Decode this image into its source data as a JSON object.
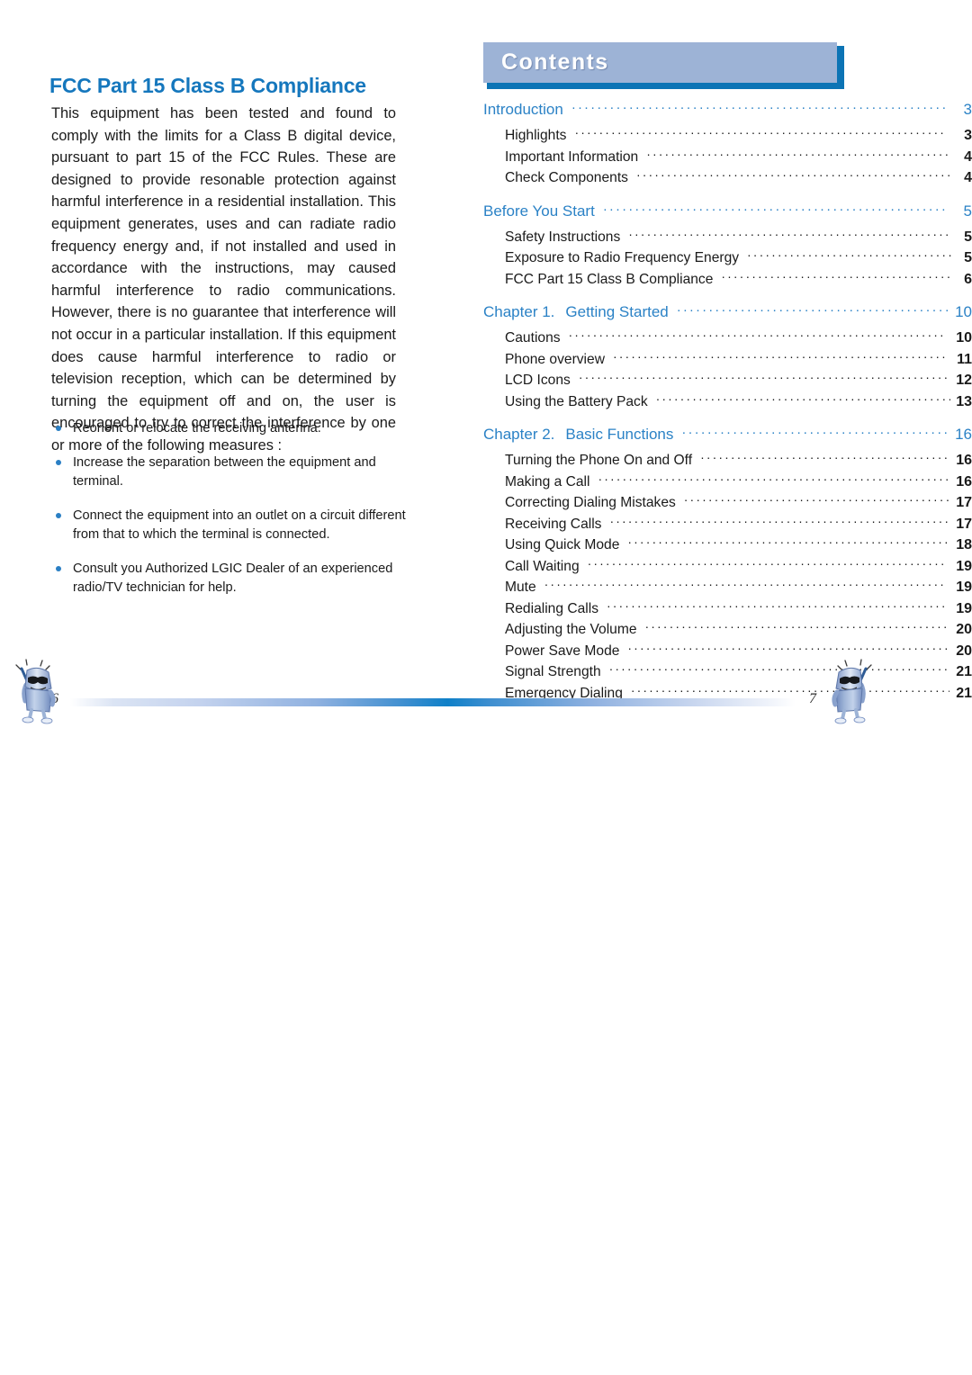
{
  "left_page": {
    "heading": "FCC Part 15 Class B Compliance",
    "body": "This equipment has been tested and found to comply with the limits for a Class B digital device, pursuant to part 15 of the FCC Rules. These are designed to provide resonable protection against harmful interference in a residential installation. This equipment generates, uses and can radiate radio frequency energy and, if not installed and used in accordance with the instructions, may caused harmful interference to radio communications. However, there is no guarantee that interference will not occur in a particular installation. If this equipment does cause harmful interference to radio or television reception, which can be determined by turning the equipment off and on, the user is encouraged to try to correct the interference by one or more of the following measures :",
    "bullets": [
      "Reorient or relocate the receiving antenna.",
      "Increase the separation between the equipment and terminal.",
      "Connect the equipment into an outlet on a circuit different from that to which the terminal is connected.",
      "Consult you Authorized LGIC Dealer of an experienced radio/TV technician for help."
    ],
    "page_number": "6"
  },
  "right_page": {
    "banner_title": "Contents",
    "page_number": "7",
    "toc": [
      {
        "heading": {
          "label": "Introduction",
          "page": "3"
        },
        "entries": [
          {
            "label": "Highlights",
            "page": "3"
          },
          {
            "label": "Important Information",
            "page": "4"
          },
          {
            "label": "Check Components",
            "page": "4"
          }
        ]
      },
      {
        "heading": {
          "label": "Before You Start",
          "page": "5"
        },
        "entries": [
          {
            "label": "Safety Instructions",
            "page": "5"
          },
          {
            "label": "Exposure to Radio Frequency Energy",
            "page": "5"
          },
          {
            "label": "FCC Part 15 Class B Compliance",
            "page": "6"
          }
        ]
      },
      {
        "heading": {
          "chapter": "Chapter 1.",
          "label": "Getting Started",
          "page": "10"
        },
        "entries": [
          {
            "label": "Cautions",
            "page": "10"
          },
          {
            "label": "Phone overview",
            "page": "11"
          },
          {
            "label": "LCD Icons",
            "page": "12"
          },
          {
            "label": "Using the Battery Pack",
            "page": "13"
          }
        ]
      },
      {
        "heading": {
          "chapter": "Chapter 2.",
          "label": "Basic Functions",
          "page": "16"
        },
        "entries": [
          {
            "label": "Turning the Phone On and Off",
            "page": "16"
          },
          {
            "label": "Making a Call",
            "page": "16"
          },
          {
            "label": "Correcting Dialing Mistakes",
            "page": "17"
          },
          {
            "label": "Receiving Calls",
            "page": "17"
          },
          {
            "label": "Using Quick Mode",
            "page": "18"
          },
          {
            "label": "Call Waiting",
            "page": "19"
          },
          {
            "label": "Mute",
            "page": "19"
          },
          {
            "label": "Redialing Calls",
            "page": "19"
          },
          {
            "label": "Adjusting the Volume",
            "page": "20"
          },
          {
            "label": "Power Save Mode",
            "page": "20"
          },
          {
            "label": "Signal Strength",
            "page": "21"
          },
          {
            "label": "Emergency Dialing",
            "page": "21"
          }
        ]
      }
    ]
  },
  "colors": {
    "heading_blue": "#1577bd",
    "toc_blue": "#2b82c6",
    "banner_fill": "#9db3d6",
    "banner_edge": "#0c74b5",
    "bullet_blue": "#2a7fc4"
  }
}
